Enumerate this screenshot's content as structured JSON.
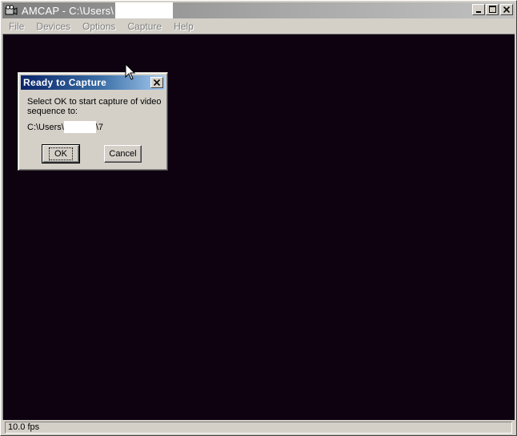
{
  "window": {
    "title": "AMCAP - C:\\Users\\",
    "icon": "camera-icon",
    "buttons": [
      "minimize-icon",
      "maximize-icon",
      "close-icon"
    ]
  },
  "menu": {
    "items": [
      "File",
      "Devices",
      "Options",
      "Capture",
      "Help"
    ]
  },
  "dialog": {
    "title": "Ready to Capture",
    "message": "Select OK to start capture of video sequence to:",
    "path_prefix": "C:\\Users\\",
    "path_suffix": "\\7",
    "ok_label": "OK",
    "cancel_label": "Cancel"
  },
  "status": {
    "fps": "10.0 fps"
  },
  "colors": {
    "video_background": "#0e0210",
    "dialog_title_start": "#0a246a",
    "dialog_title_end": "#a6caf0",
    "chrome": "#d4d0c8"
  }
}
